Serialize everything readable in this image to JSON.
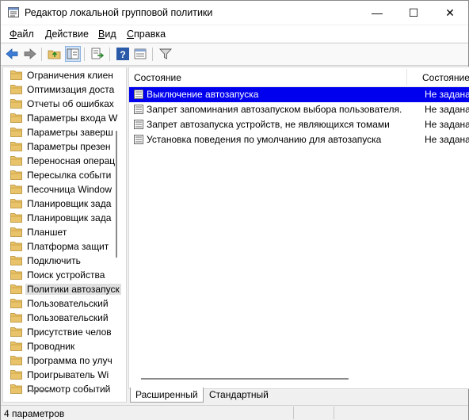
{
  "window": {
    "title": "Редактор локальной групповой политики",
    "minimize_glyph": "—",
    "maximize_glyph": "☐",
    "close_glyph": "✕"
  },
  "menu": {
    "file_u": "Ф",
    "file_rest": "айл",
    "action_u": "Д",
    "action_rest": "ействие",
    "view_u": "В",
    "view_rest": "ид",
    "help_u": "С",
    "help_rest": "правка"
  },
  "toolbar": {
    "icons": [
      "back-arrow-icon",
      "forward-arrow-icon",
      "up-folder-icon",
      "show-hide-tree-icon",
      "export-list-icon",
      "help-icon",
      "properties-icon",
      "filter-icon"
    ]
  },
  "tree": {
    "items": [
      {
        "label": "Ограничения клиен"
      },
      {
        "label": "Оптимизация доста"
      },
      {
        "label": "Отчеты об ошибках"
      },
      {
        "label": "Параметры входа W"
      },
      {
        "label": "Параметры заверш"
      },
      {
        "label": "Параметры презен"
      },
      {
        "label": "Переносная операц"
      },
      {
        "label": "Пересылка событи"
      },
      {
        "label": "Песочница Window"
      },
      {
        "label": "Планировщик зада"
      },
      {
        "label": "Планировщик зада"
      },
      {
        "label": "Планшет"
      },
      {
        "label": "Платформа защит"
      },
      {
        "label": "Подключить"
      },
      {
        "label": "Поиск устройства"
      },
      {
        "label": "Политики автозапуск"
      },
      {
        "label": "Пользовательский"
      },
      {
        "label": "Пользовательский"
      },
      {
        "label": "Присутствие челов"
      },
      {
        "label": "Проводник"
      },
      {
        "label": "Программа по улуч"
      },
      {
        "label": "Проигрыватель Wi"
      },
      {
        "label": "Просмотр событий"
      }
    ],
    "selected_index": 15
  },
  "list": {
    "col_name": "Состояние",
    "col_state": "Состояние",
    "rows": [
      {
        "name": "Выключение автозапуска",
        "state": "Не задана"
      },
      {
        "name": "Запрет запоминания автозапуском выбора пользователя.",
        "state": "Не задана"
      },
      {
        "name": "Запрет автозапуска устройств, не являющихся томами",
        "state": "Не задана"
      },
      {
        "name": "Установка поведения по умолчанию для автозапуска",
        "state": "Не задана"
      }
    ]
  },
  "tabs": {
    "extended": "Расширенный",
    "standard": "Стандартный"
  },
  "status": {
    "text": "4 параметров"
  },
  "colors": {
    "selection": "#0000ee",
    "folder": "#e8c36a"
  }
}
